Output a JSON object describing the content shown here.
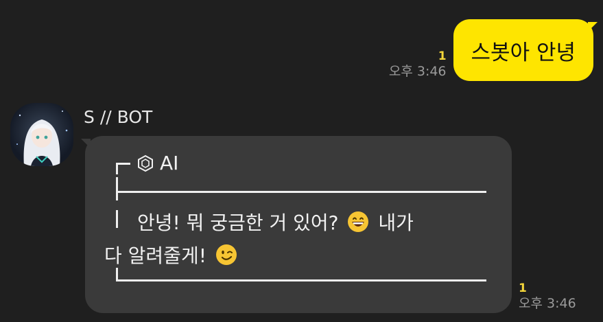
{
  "outgoing_message": {
    "unread_count": "1",
    "time": "오후 3:46",
    "text": "스봇아 안녕"
  },
  "incoming_message": {
    "sender": "S // BOT",
    "header_icon": "hexagon-icon",
    "header_label": "AI",
    "text_line_1": "안녕! 뭐 궁금한 거 있어?",
    "text_line_1_suffix": "내가",
    "text_line_2": "다 알려줄게!",
    "emoji_1": "grinning-face-icon",
    "emoji_2": "winking-face-icon",
    "unread_count": "1",
    "time": "오후 3:46"
  },
  "colors": {
    "background": "#1f1f1f",
    "outgoing_bubble": "#fee500",
    "incoming_bubble": "#3a3a3a",
    "unread": "#f5d63a",
    "time": "#9b9b9b"
  }
}
